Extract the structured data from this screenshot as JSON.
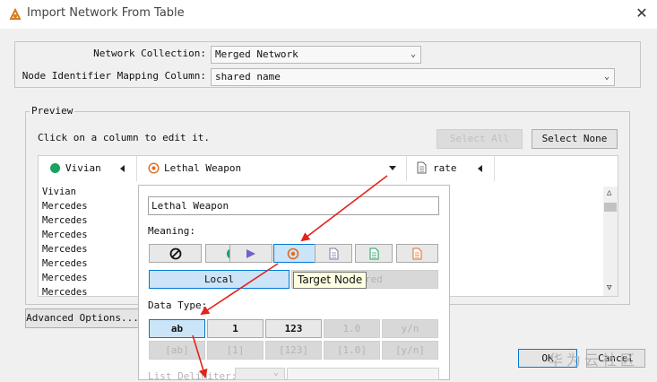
{
  "window": {
    "title": "Import Network From Table",
    "close_glyph": "✕"
  },
  "network_collection": {
    "label": "Network Collection:",
    "value": "Merged Network"
  },
  "mapping_column": {
    "label": "Node Identifier Mapping Column:",
    "value": "shared name"
  },
  "preview": {
    "legend": "Preview",
    "hint": "Click on a column to edit it.",
    "select_all": "Select All",
    "select_none": "Select None",
    "columns": [
      {
        "name": "Vivian",
        "icon": "source-node-icon"
      },
      {
        "name": "Lethal Weapon",
        "icon": "target-node-icon"
      },
      {
        "name": "rate",
        "icon": "attribute-icon"
      }
    ],
    "rows": [
      "Vivian",
      "Mercedes",
      "Mercedes",
      "Mercedes",
      "Mercedes",
      "Mercedes",
      "Mercedes",
      "Mercedes"
    ]
  },
  "editor": {
    "column_name": "Lethal Weapon",
    "meaning_label": "Meaning:",
    "local_label": "Local",
    "shared_label": "Shared",
    "data_type_label": "Data Type:",
    "types_row1": [
      "ab",
      "1",
      "123",
      "1.0",
      "y/n"
    ],
    "types_row2": [
      "[ab]",
      "[1]",
      "[123]",
      "[1.0]",
      "[y/n]"
    ],
    "list_delimiter_label": "List Delimiter:",
    "tooltip": "Target Node",
    "meaning_icons": [
      "not-imported-icon",
      "source-node-icon",
      "interaction-icon",
      "target-node-icon",
      "source-attribute-icon",
      "edge-attribute-icon",
      "target-attribute-icon"
    ]
  },
  "footer": {
    "advanced_options": "Advanced Options...",
    "ok": "OK",
    "cancel": "Cancel"
  },
  "watermark": "华为云社区",
  "colors": {
    "accent": "#0078d7",
    "source_node": "#1aa260",
    "target_node": "#e06b1e",
    "interaction": "#6f63c9",
    "arrow": "#e2231a"
  }
}
